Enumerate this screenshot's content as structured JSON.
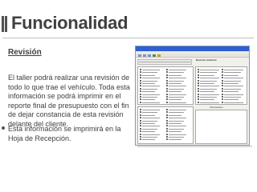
{
  "slide": {
    "title": "Funcionalidad",
    "subtitle": "Revisión",
    "paragraph1": "El taller podrá realizar una revisión de todo lo que trae el vehículo. Toda esta información se podrá imprimir en el reporte final de presupuesto con el fin de dejar constancia de esta revisión delante del cliente.",
    "paragraph2": "Esta información se imprimirá en la Hoja de Recepción."
  },
  "screenshot": {
    "form_title": "Revisión Vehículo",
    "observaciones_label": "Observaciones"
  },
  "colors": {
    "title_text": "#404040",
    "accent_bar": "#4f4f4f",
    "window_titlebar": "#2f5fd0"
  }
}
